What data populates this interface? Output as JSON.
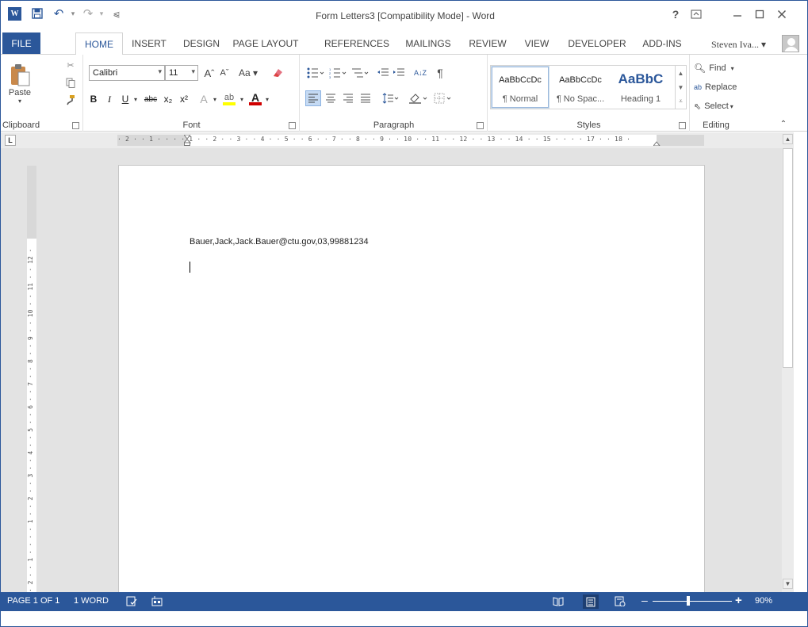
{
  "window": {
    "title": "Form Letters3 [Compatibility Mode] - Word",
    "help_label": "?",
    "controls": [
      "▭",
      "–",
      "□",
      "✕"
    ]
  },
  "qat": {
    "logo_letter": "W",
    "save_icon": "save-icon",
    "undo_glyph": "↶",
    "redo_glyph": "↷",
    "customize_glyph": "⩿"
  },
  "tabs": [
    "FILE",
    "HOME",
    "INSERT",
    "DESIGN",
    "PAGE LAYOUT",
    "REFERENCES",
    "MAILINGS",
    "REVIEW",
    "VIEW",
    "DEVELOPER",
    "ADD-INS"
  ],
  "active_tab": "HOME",
  "user": {
    "name": "Steven Iva...",
    "dropdown": "▾"
  },
  "clipboard": {
    "paste_label": "Paste",
    "group_label": "Clipboard"
  },
  "font": {
    "font_name": "Calibri",
    "font_size": "11",
    "grow": "Aˆ",
    "shrink": "Aˇ",
    "change_case": "Aa ▾",
    "bold": "B",
    "italic": "I",
    "underline": "U",
    "strikethrough": "abc",
    "subscript": "x₂",
    "superscript": "x²",
    "text_effects": "A",
    "highlight": "ab",
    "font_color": "A",
    "group_label": "Font"
  },
  "paragraph": {
    "group_label": "Paragraph",
    "pilcrow": "¶",
    "sort": "A↓Z"
  },
  "styles": {
    "group_label": "Styles",
    "items": [
      {
        "sample": "AaBbCcDc",
        "name": "¶ Normal"
      },
      {
        "sample": "AaBbCcDc",
        "name": "¶ No Spac..."
      },
      {
        "sample": "AaBbC",
        "name": "Heading 1"
      }
    ]
  },
  "editing": {
    "group_label": "Editing",
    "find": "Find",
    "replace": "Replace",
    "select": "Select"
  },
  "ruler": {
    "tab_selector": "L",
    "h_text": "· 2 · · 1 · · · · 1 · · 2 · · 3 · · 4 · · 5 · · 6 · · 7 · · 8 · · 9 · · 10 · · 11 · · 12 · · 13 · · 14 · · 15 · · · · 17 · · 18 ·",
    "v_text": "· 2 · · 1 · · · · 1 · · 2 · · 3 · · 4 · · 5 · · 6 · · 7 · · 8 · · 9 · · 10 · · 11 · · 12 ·"
  },
  "document": {
    "line1": "Bauer,Jack,Jack.Bauer@ctu.gov,03,99881234"
  },
  "status": {
    "page": "PAGE 1 OF 1",
    "words": "1 WORD",
    "zoom_minus": "–",
    "zoom_plus": "+",
    "zoom": "90%",
    "zoom_fraction": 0.45
  },
  "colors": {
    "accent": "#2b579a",
    "font_color_bar": "#d00000",
    "highlight_bar": "#ffff00"
  }
}
